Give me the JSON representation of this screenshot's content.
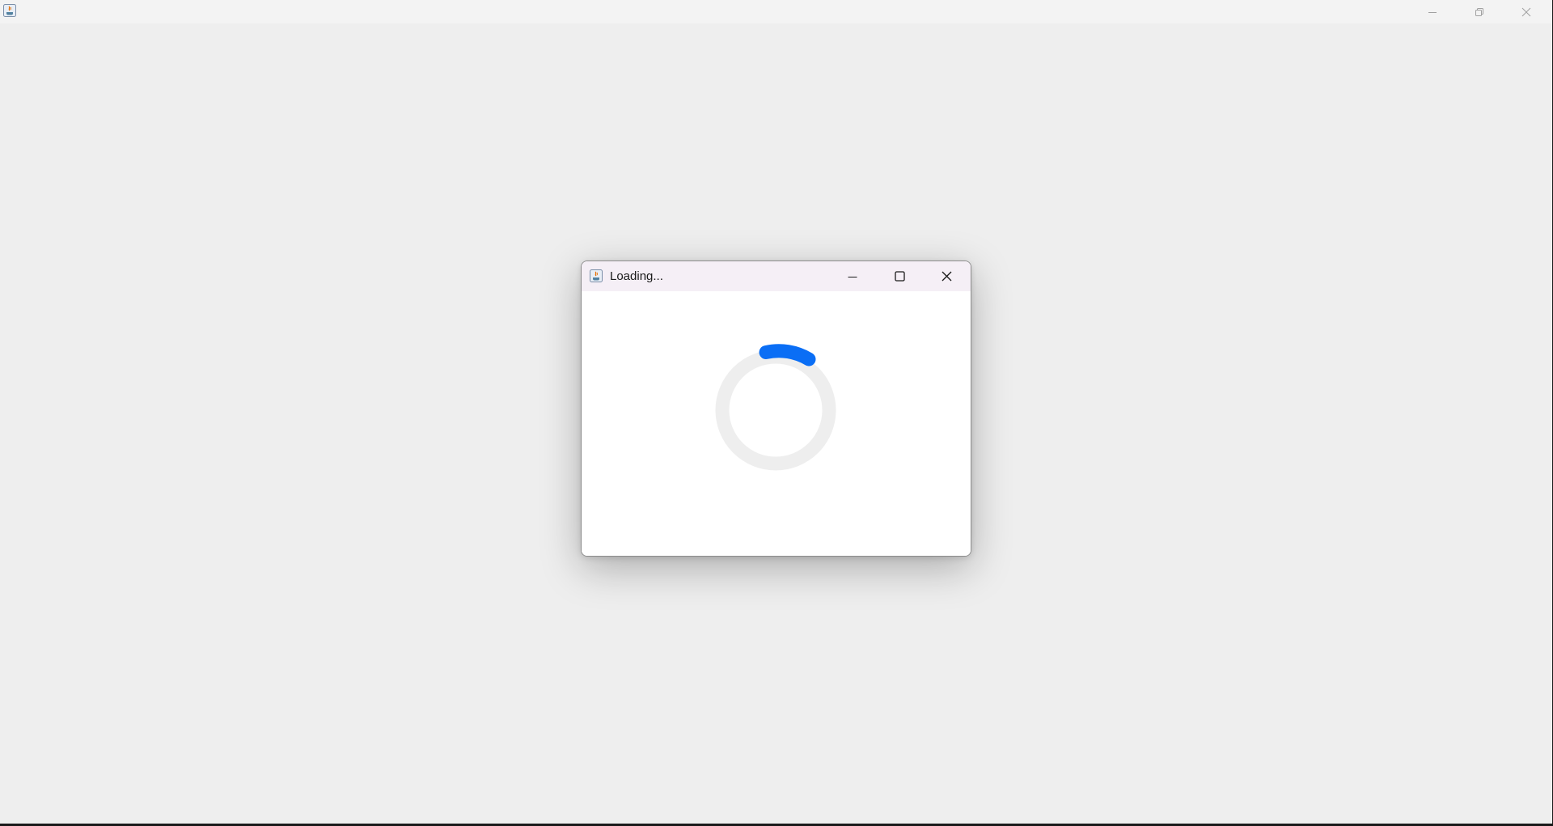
{
  "main_window": {
    "title": "",
    "icon": "java-icon",
    "controls": [
      "minimize-icon",
      "restore-icon",
      "close-icon"
    ]
  },
  "dialog": {
    "title": "Loading...",
    "icon": "java-icon",
    "controls": [
      "minimize-icon",
      "maximize-icon",
      "close-icon"
    ],
    "spinner": {
      "track_color": "#eeeeee",
      "arc_color": "#0a6ef5"
    }
  },
  "colors": {
    "desktop_background": "#eeeeee",
    "dialog_titlebar": "#f5eff6",
    "dialog_background": "#ffffff"
  }
}
